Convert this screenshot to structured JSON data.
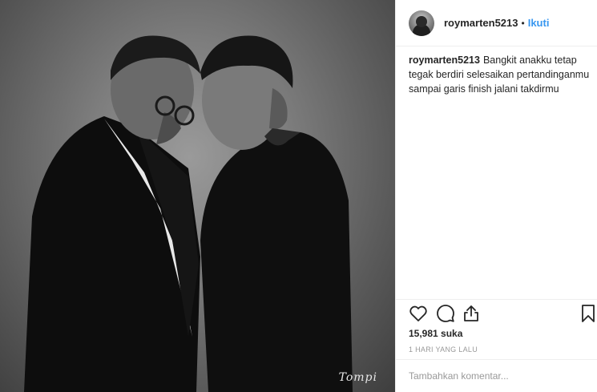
{
  "post": {
    "photo": {
      "signature": "Tompi"
    },
    "header": {
      "username": "roymarten5213",
      "separator": "•",
      "follow_label": "Ikuti"
    },
    "caption": {
      "username": "roymarten5213",
      "text": "Bangkit anakku tetap tegak berdiri selesaikan pertandinganmu sampai garis finish jalani takdirmu"
    },
    "actions": {
      "icons": [
        "heart-icon",
        "comment-icon",
        "share-icon",
        "bookmark-icon"
      ]
    },
    "likes": "15,981 suka",
    "timestamp": "1 HARI YANG LALU",
    "comment": {
      "placeholder": "Tambahkan komentar...",
      "value": ""
    },
    "colors": {
      "link": "#3897f0",
      "text": "#262626",
      "muted": "#999999",
      "border": "#efefef"
    }
  }
}
